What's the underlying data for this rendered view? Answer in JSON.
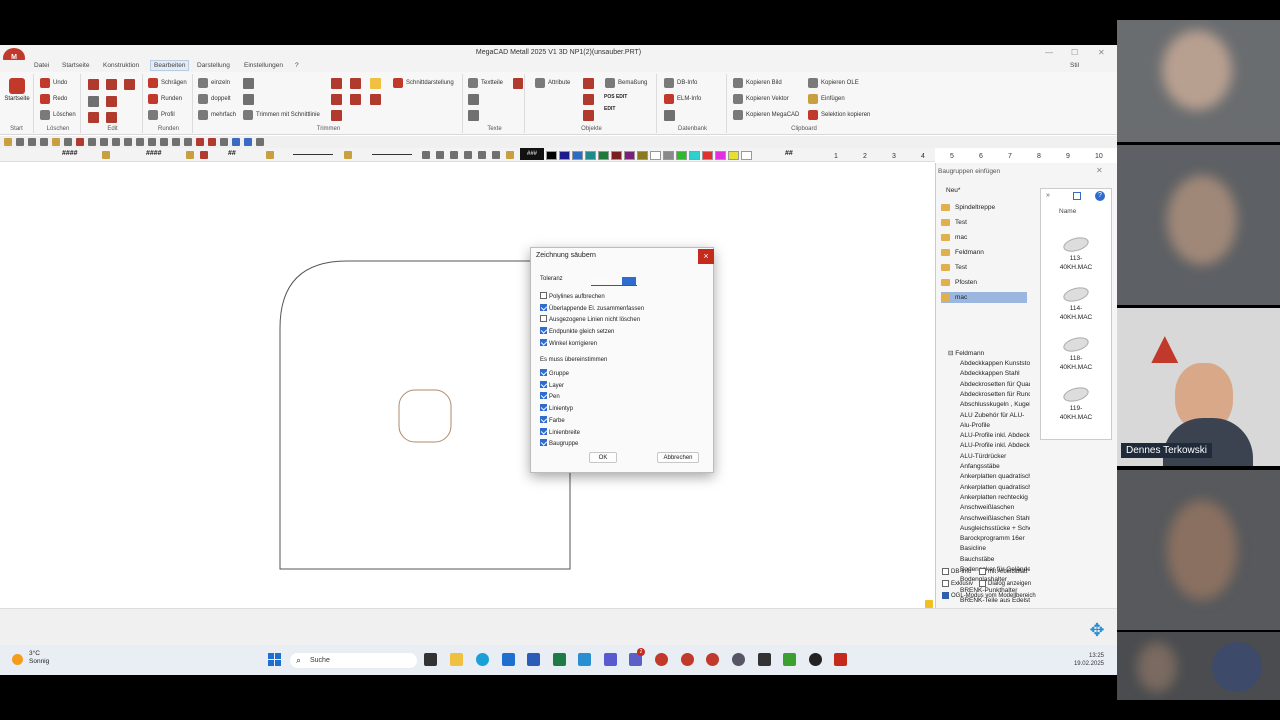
{
  "window": {
    "title": "MegaCAD Metall 2025 V1 3D NP1(2)(unsauber.PRT)",
    "logo": "M"
  },
  "menu": {
    "items": [
      "Datei",
      "Startseite",
      "Konstruktion",
      "Bearbeiten",
      "Darstellung",
      "Einstellungen",
      "?"
    ],
    "active": "Bearbeiten"
  },
  "ribbon": {
    "start_label": "Startseite",
    "undo": "Undo",
    "redo": "Redo",
    "loeschen": "Löschen",
    "schraegen": "Schrägen",
    "runden": "Runden",
    "profil": "Profil",
    "einzeln": "einzeln",
    "doppelt": "doppelt",
    "mehrfach": "mehrfach",
    "trimmen_schnittlinie": "Trimmen mit Schnittlinie",
    "schnittdarstellung": "Schnittdarstellung",
    "textteile": "Textteile",
    "attribute": "Attribute",
    "bemassung": "Bemaßung",
    "db_info": "DB-Info",
    "elm_info": "ELM-Info",
    "kopieren_bild": "Kopieren Bild",
    "kopieren_vektor": "Kopieren Vektor",
    "kopieren_megacad": "Kopieren MegaCAD",
    "kopieren_ole": "Kopieren OLE",
    "einfuegen": "Einfügen",
    "selektion_kopieren": "Selektion kopieren",
    "pos_edit": "POS EDIT",
    "edit": "EDIT",
    "groups": {
      "start": "Start",
      "loeschen": "Löschen",
      "edit": "Edit",
      "runden": "Runden",
      "trimmen": "Trimmen",
      "texte": "Texte",
      "objekte": "Objekte",
      "datenbank": "Datenbank",
      "clipboard": "Clipboard"
    },
    "user": "Stil"
  },
  "toolbar": {
    "hash_labels": [
      "####",
      "####",
      "##",
      "###",
      "##"
    ],
    "palette": [
      "#000000",
      "#1c1c8c",
      "#2d6cc0",
      "#1f8a8a",
      "#1f7a3a",
      "#7a1f1f",
      "#7a1f7a",
      "#8a7a1f",
      "#ffffff",
      "#8a8a8a",
      "#2fb82f",
      "#2fd0d0",
      "#e03030",
      "#e030e0",
      "#e8e030",
      "#ffffff"
    ],
    "numbers": [
      "1",
      "2",
      "3",
      "4",
      "5",
      "6",
      "7",
      "8",
      "9",
      "10"
    ]
  },
  "panel": {
    "header": "Baugruppen einfügen",
    "top_entry": "Neu*",
    "folders": [
      "Spindeltreppe",
      "Test",
      "mac",
      "Feldmann",
      "Test",
      "Pfosten",
      "mac"
    ],
    "selected_folder_index": 6,
    "subfolder": "Feldmann",
    "items": [
      "Abdeckkappen Kunststoff",
      "Abdeckkappen Stahl",
      "Abdeckrosetten für Quadrat",
      "Abdeckrosetten für Rund",
      "Abschlusskugeln , Kugeln",
      "ALU Zubehör für ALU-",
      "Alu-Profile",
      "ALU-Profile inkl. Abdeckungen",
      "ALU-Profile inkl. Abdeckungen",
      "ALU-Türdrücker",
      "Anfangsstäbe",
      "Ankerplatten quadratisch",
      "Ankerplatten quadratisch",
      "Ankerplatten rechteckig",
      "Anschweißlaschen",
      "Anschweißlaschen Stahl",
      "Ausgleichsstücke + Scheiben",
      "Barockprogramm 16er",
      "Basicline",
      "Bauchstäbe",
      "Bodenanker für Geländer",
      "Bodenglashalter",
      "BRENK-Punkthalter",
      "BRENK-Teile aus Edelstahl"
    ],
    "column_name": "Name",
    "thumbnails": [
      "113-40KH.MAC",
      "114-40KH.MAC",
      "118-40KH.MAC",
      "119-40KH.MAC"
    ],
    "options": {
      "db_info": "DB-Info",
      "mit_arbeitsblatt": "mit Arbeitsblatt",
      "exklusiv": "Exklusiv",
      "dialog_anzeigen": "Dialog anzeigen",
      "ogl_modus": "OGL-Modus vom Modellbereich"
    }
  },
  "dialog": {
    "title": "Zeichnung säubern",
    "close": "×",
    "tolerance_label": "Toleranz",
    "tolerance_value": "0.001",
    "options": [
      {
        "label": "Polylines aufbrechen",
        "checked": false
      },
      {
        "label": "Überlappende El. zusammenfassen",
        "checked": true
      },
      {
        "label": "Ausgezogene Linien nicht löschen",
        "checked": false
      },
      {
        "label": "Endpunkte gleich setzen",
        "checked": true
      },
      {
        "label": "Winkel korrigieren",
        "checked": true
      }
    ],
    "must_match_label": "Es muss übereinstimmen",
    "match_options": [
      {
        "label": "Gruppe",
        "checked": true
      },
      {
        "label": "Layer",
        "checked": true
      },
      {
        "label": "Pen",
        "checked": true
      },
      {
        "label": "Linientyp",
        "checked": true
      },
      {
        "label": "Farbe",
        "checked": true
      },
      {
        "label": "Linienbreite",
        "checked": true
      },
      {
        "label": "Baugruppe",
        "checked": true
      }
    ],
    "ok": "OK",
    "cancel": "Abbrechen"
  },
  "taskbar": {
    "weather_temp": "3°C",
    "weather_text": "Sonnig",
    "search": "Suche",
    "time": "13:25",
    "date": "19.02.2025",
    "badge": "2"
  },
  "video": {
    "participant_name": "Dennes Terkowski"
  }
}
